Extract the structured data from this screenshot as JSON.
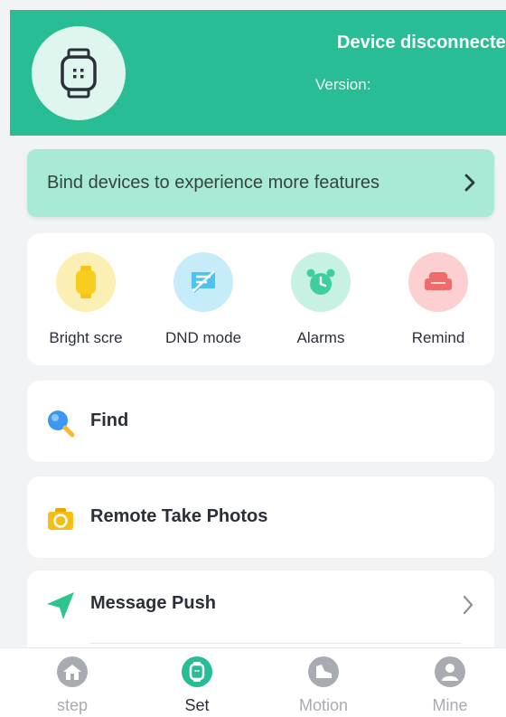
{
  "header": {
    "status": "Device disconnected",
    "version_label": "Version:"
  },
  "bind_banner": {
    "text": "Bind devices to experience more features"
  },
  "quick_actions": [
    {
      "label": "Bright scre",
      "icon": "watch-icon",
      "color": "#f7ce1c"
    },
    {
      "label": "DND mode",
      "icon": "message-off-icon",
      "color": "#4ec3f0"
    },
    {
      "label": "Alarms",
      "icon": "alarm-clock-icon",
      "color": "#3fcf9f"
    },
    {
      "label": "Remind",
      "icon": "sofa-icon",
      "color": "#f06b6b"
    }
  ],
  "menu": {
    "find": "Find",
    "remote_photos": "Remote Take Photos",
    "message_push": "Message Push"
  },
  "tabs": [
    {
      "label": "step",
      "icon": "home-icon",
      "active": false
    },
    {
      "label": "Set",
      "icon": "watch-icon",
      "active": true
    },
    {
      "label": "Motion",
      "icon": "shoe-icon",
      "active": false
    },
    {
      "label": "Mine",
      "icon": "person-icon",
      "active": false
    }
  ],
  "colors": {
    "accent": "#28bd95",
    "banner": "#a9ead6",
    "tab_inactive": "#a8abb2",
    "tab_active": "#2b2f3a"
  }
}
